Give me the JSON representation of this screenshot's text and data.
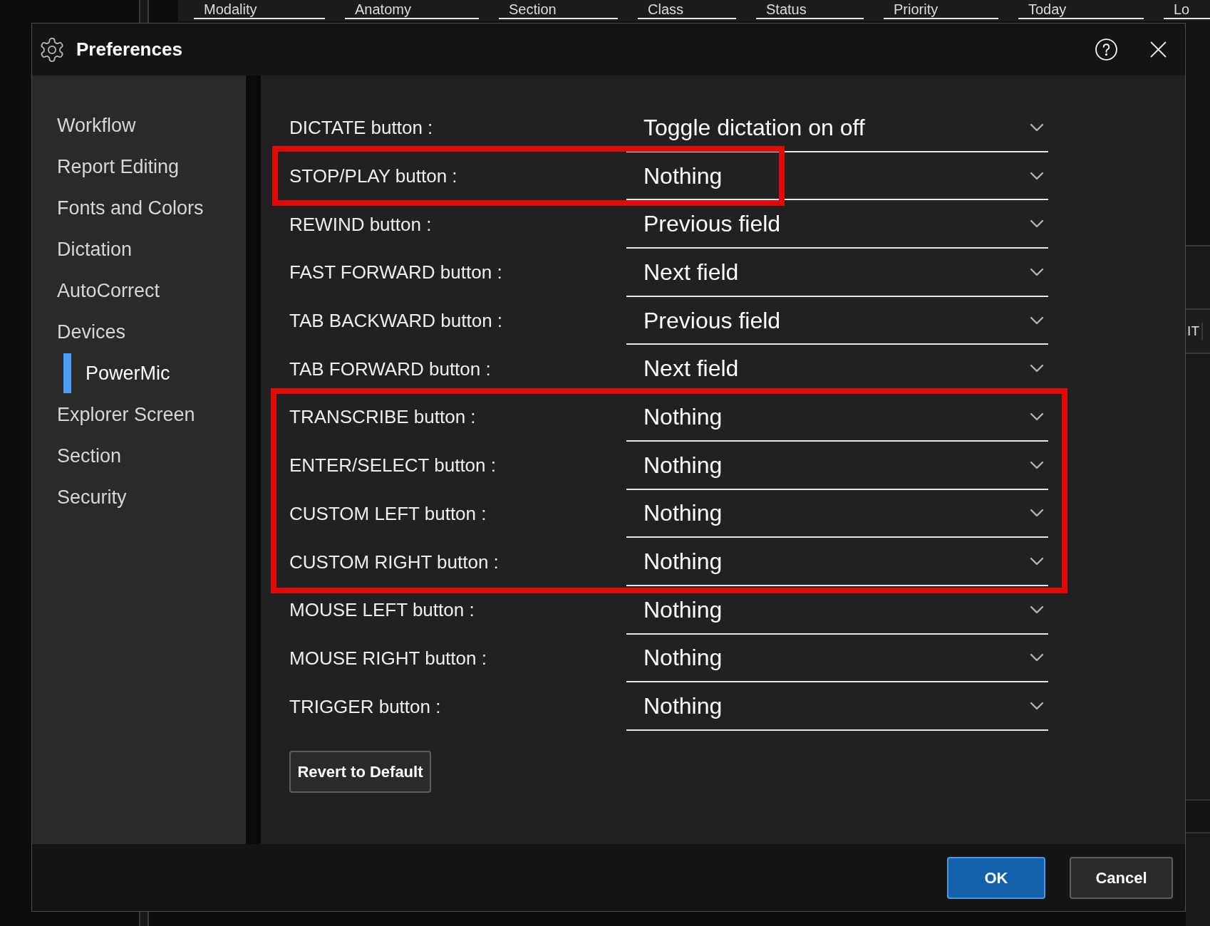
{
  "background": {
    "filters": [
      {
        "label": "Modality"
      },
      {
        "label": "Anatomy"
      },
      {
        "label": "Section"
      },
      {
        "label": "Class"
      },
      {
        "label": "Status"
      },
      {
        "label": "Priority"
      },
      {
        "label": "Today"
      },
      {
        "label": "Lo"
      }
    ],
    "table_cell": "IT"
  },
  "dialog": {
    "title": "Preferences",
    "sidebar": {
      "items": [
        {
          "label": "Workflow",
          "selected": false
        },
        {
          "label": "Report Editing",
          "selected": false
        },
        {
          "label": "Fonts and Colors",
          "selected": false
        },
        {
          "label": "Dictation",
          "selected": false
        },
        {
          "label": "AutoCorrect",
          "selected": false
        },
        {
          "label": "Devices",
          "selected": false,
          "children": [
            {
              "label": "PowerMic",
              "selected": true
            }
          ]
        },
        {
          "label": "Explorer Screen",
          "selected": false
        },
        {
          "label": "Section",
          "selected": false
        },
        {
          "label": "Security",
          "selected": false
        }
      ]
    },
    "row_groups": [
      {
        "kind": "plain",
        "rows": [
          {
            "label": "DICTATE button :",
            "value": "Toggle dictation on off"
          }
        ]
      },
      {
        "kind": "framed_narrow",
        "rows": [
          {
            "label": "STOP/PLAY button :",
            "value": "Nothing"
          }
        ]
      },
      {
        "kind": "plain",
        "rows": [
          {
            "label": "REWIND button :",
            "value": "Previous field"
          },
          {
            "label": "FAST FORWARD button :",
            "value": "Next field"
          },
          {
            "label": "TAB BACKWARD button :",
            "value": "Previous field"
          },
          {
            "label": "TAB FORWARD button :",
            "value": "Next field"
          }
        ]
      },
      {
        "kind": "framed_wide",
        "rows": [
          {
            "label": "TRANSCRIBE button :",
            "value": "Nothing"
          },
          {
            "label": "ENTER/SELECT button :",
            "value": "Nothing"
          },
          {
            "label": "CUSTOM LEFT button :",
            "value": "Nothing"
          },
          {
            "label": "CUSTOM RIGHT button :",
            "value": "Nothing"
          }
        ]
      },
      {
        "kind": "plain",
        "rows": [
          {
            "label": "MOUSE LEFT button :",
            "value": "Nothing"
          },
          {
            "label": "MOUSE RIGHT button :",
            "value": "Nothing"
          },
          {
            "label": "TRIGGER button :",
            "value": "Nothing"
          }
        ]
      }
    ],
    "revert_button": "Revert to Default",
    "buttons": [
      {
        "label": "OK",
        "kind": "primary"
      },
      {
        "label": "Cancel",
        "kind": "secondary"
      }
    ]
  }
}
